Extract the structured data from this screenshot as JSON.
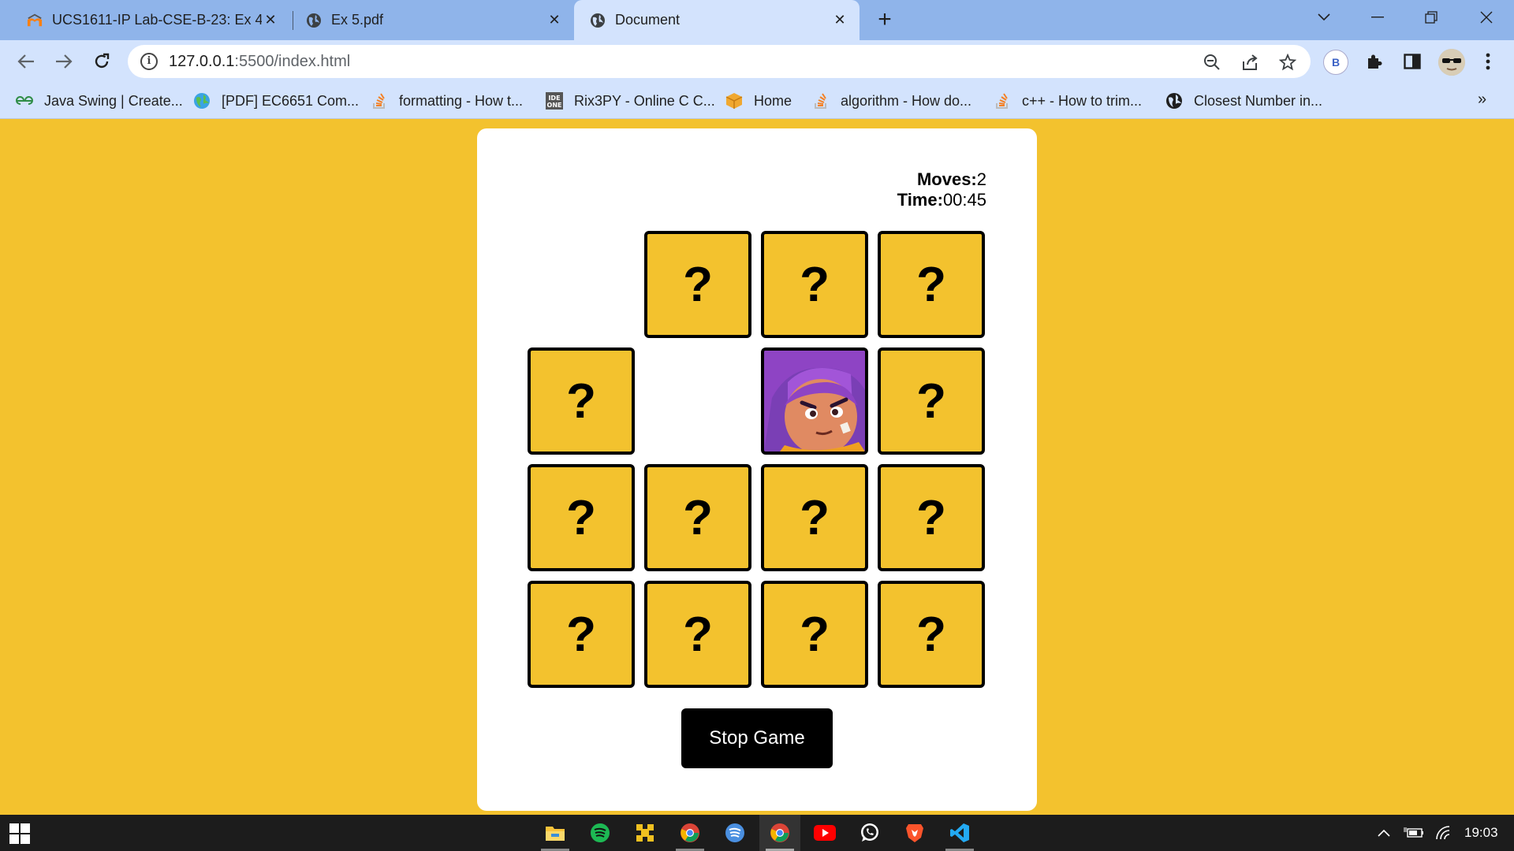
{
  "browser": {
    "tabs": [
      {
        "title": "UCS1611-IP Lab-CSE-B-23: Ex 4:",
        "icon": "moodle-icon"
      },
      {
        "title": "Ex 5.pdf",
        "icon": "globe-icon"
      },
      {
        "title": "Document",
        "icon": "globe-icon",
        "active": true
      }
    ],
    "address": {
      "host": "127.0.0.1",
      "path": ":5500/index.html"
    },
    "profile_initial": "B",
    "bookmarks": [
      {
        "label": "Java Swing | Create...",
        "icon": "geeksforgeeks-icon"
      },
      {
        "label": "[PDF] EC6651 Com...",
        "icon": "globe-color-icon"
      },
      {
        "label": "formatting - How t...",
        "icon": "stackoverflow-icon"
      },
      {
        "label": "Rix3PY - Online C C...",
        "icon": "ideone-icon"
      },
      {
        "label": "Home",
        "icon": "box-icon"
      },
      {
        "label": "algorithm - How do...",
        "icon": "stackoverflow-icon"
      },
      {
        "label": "c++ - How to trim...",
        "icon": "stackoverflow-icon"
      },
      {
        "label": "Closest Number in...",
        "icon": "globe-icon"
      }
    ]
  },
  "game": {
    "moves_label": "Moves:",
    "moves_value": "2",
    "time_label": "Time:",
    "time_value": "00:45",
    "hidden_symbol": "?",
    "stop_button": "Stop Game",
    "cells": [
      "matched",
      "hidden",
      "hidden",
      "hidden",
      "hidden",
      "matched",
      "revealed",
      "hidden",
      "hidden",
      "hidden",
      "hidden",
      "hidden",
      "hidden",
      "hidden",
      "hidden",
      "hidden"
    ]
  },
  "taskbar": {
    "apps": [
      "file-explorer-icon",
      "spotify-icon",
      "app-icon",
      "chrome-icon",
      "spotify-alt-icon",
      "chrome-active-icon",
      "youtube-icon",
      "whatsapp-icon",
      "brave-icon",
      "vscode-icon"
    ],
    "clock": "19:03"
  },
  "colors": {
    "page_bg": "#f3c22e",
    "card_bg": "#ffffff",
    "tile_bg": "#f3c22e",
    "button_bg": "#000000"
  }
}
